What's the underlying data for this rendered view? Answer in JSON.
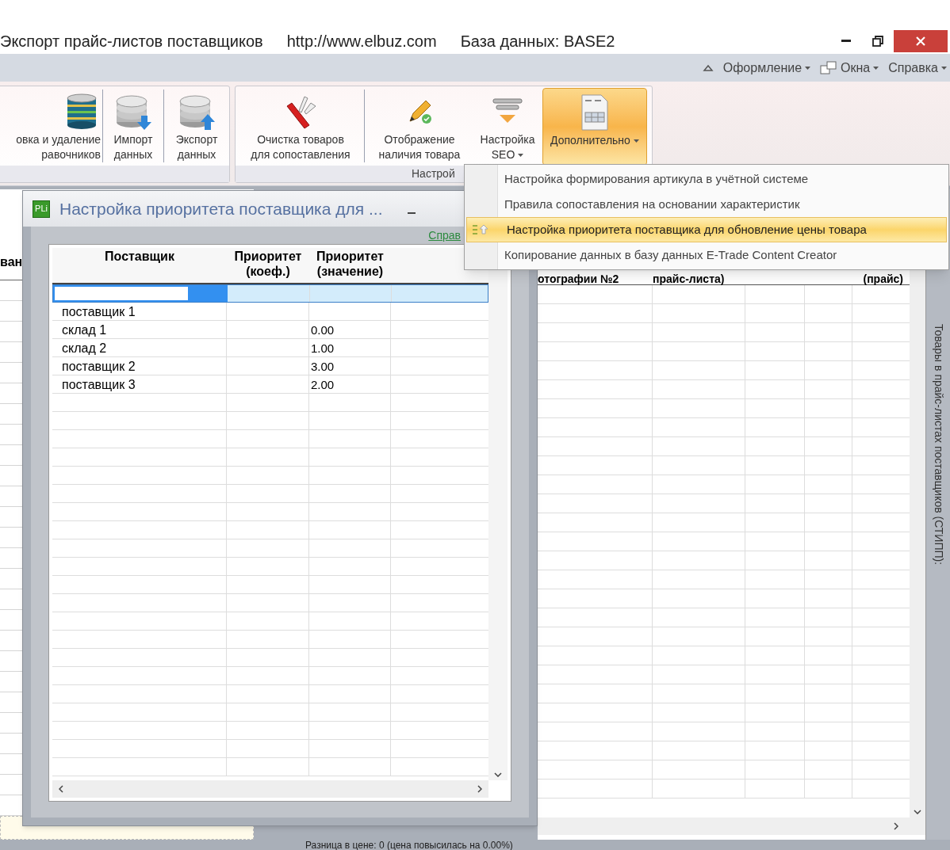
{
  "window": {
    "title": "Экспорт прайс-листов поставщиков",
    "url": "http://www.elbuz.com",
    "database": "База данных: BASE2"
  },
  "menu": [
    {
      "label": "Оформление"
    },
    {
      "label": "Окна"
    },
    {
      "label": "Справка"
    }
  ],
  "ribbon": {
    "groups": [
      {
        "buttons": [
          {
            "label": "овка и удаление\nравочников",
            "has_menu": false,
            "selected": false
          },
          {
            "label": "Импорт\nданных",
            "has_menu": false,
            "selected": false
          },
          {
            "label": "Экспорт\nданных",
            "has_menu": false,
            "selected": false
          }
        ]
      },
      {
        "label": "Настрой",
        "buttons": [
          {
            "label": "Очистка товаров\nдля сопоставления",
            "has_menu": false,
            "selected": false
          },
          {
            "label": "Отображение\nналичия товара",
            "has_menu": false,
            "selected": false
          },
          {
            "label": "Настройка\nSEO",
            "has_menu": true,
            "selected": false
          },
          {
            "label": "Дополнительно",
            "has_menu": true,
            "selected": true
          }
        ]
      }
    ]
  },
  "dropdown": {
    "items": [
      {
        "label": "Настройка формирования артикула в учётной системе",
        "selected": false
      },
      {
        "label": "Правила сопоставления на основании характеристик",
        "selected": false
      },
      {
        "label": "Настройка приоритета поставщика для обновление цены товара",
        "selected": true
      },
      {
        "label": "Копирование данных в базу данных E-Trade Content Creator",
        "selected": false
      }
    ]
  },
  "dialog": {
    "icon_label": "PLi",
    "title": "Настройка приоритета поставщика для ...",
    "help_link": "Справ",
    "table": {
      "columns": [
        "Поставщик",
        "Приоритет\n(коеф.)",
        "Приоритет\n(значение)"
      ],
      "rows": [
        {
          "selected": true
        },
        {
          "supplier": "поставщик 1",
          "selected": false
        },
        {
          "supplier": "склад 1",
          "value": "0.00",
          "selected": false
        },
        {
          "supplier": "склад 2",
          "value": "1.00",
          "selected": false
        },
        {
          "supplier": "поставщик 2",
          "value": "3.00",
          "selected": false
        },
        {
          "supplier": "поставщик 3",
          "value": "2.00",
          "selected": false
        }
      ]
    }
  },
  "left_panel": {
    "header": "ван"
  },
  "right_panel": {
    "headers": [
      "отографии №2",
      "прайс-листа)",
      "(прайс)"
    ],
    "side_tab": "Товары в прайс-листах поставщиков (СТИПП):"
  },
  "status": "Разница в цене: 0  (цена повысилась на 0.00%)"
}
